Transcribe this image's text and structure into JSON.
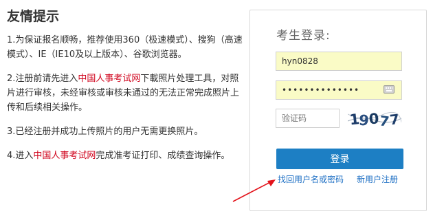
{
  "tips": {
    "title": "友情提示",
    "items": [
      {
        "before": "1.为保证报名顺畅，推荐使用360（极速模式）、搜狗（高速模式）、IE（IE10及以上版本）、谷歌浏览器。",
        "link": "",
        "after": ""
      },
      {
        "before": "2.注册前请先进入",
        "link": "中国人事考试网",
        "after": "下載照片处理工具，对照片进行审核，未经审核或审核未通过的无法正常完成照片上传和后续相关操作。"
      },
      {
        "before": "3.已经注册并成功上传照片的用户无需更换照片。",
        "link": "",
        "after": ""
      },
      {
        "before": "4.进入",
        "link": "中国人事考试网",
        "after": "完成准考证打印、成绩查询操作。"
      }
    ],
    "highlight_color": "#d0021b"
  },
  "login": {
    "title": "考生登录:",
    "username_value": "hyn0828",
    "password_value": "••••••••••••••",
    "captcha_placeholder": "验证码",
    "captcha_image_text": "19077",
    "submit_label": "登录",
    "forgot_link": "找回用户名或密码",
    "register_link": "新用户注册",
    "accent_color": "#1d7fc4"
  },
  "icons": {
    "keyboard": "keyboard-icon",
    "arrow": "red-arrow-icon"
  }
}
